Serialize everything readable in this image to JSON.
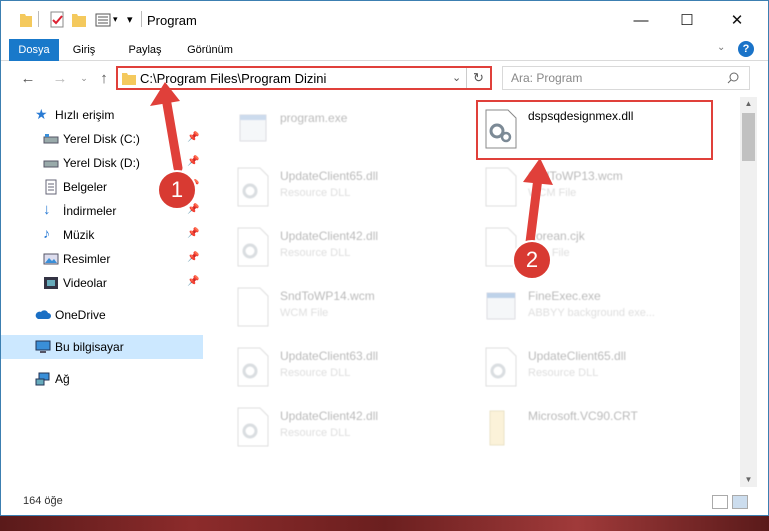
{
  "window": {
    "title": "Program"
  },
  "ribbon": {
    "tabs": [
      "Dosya",
      "Giriş",
      "Paylaş",
      "Görünüm"
    ]
  },
  "address": {
    "path": "C:\\Program Files\\Program Dizini"
  },
  "search": {
    "placeholder": "Ara: Program"
  },
  "sidebar": {
    "items": [
      {
        "label": "Hızlı erişim",
        "icon": "star-icon"
      },
      {
        "label": "Yerel Disk (C:)",
        "icon": "drive-icon"
      },
      {
        "label": "Yerel Disk (D:)",
        "icon": "drive-icon"
      },
      {
        "label": "Belgeler",
        "icon": "documents-icon"
      },
      {
        "label": "İndirmeler",
        "icon": "download-icon"
      },
      {
        "label": "Müzik",
        "icon": "music-icon"
      },
      {
        "label": "Resimler",
        "icon": "pictures-icon"
      },
      {
        "label": "Videolar",
        "icon": "video-icon"
      },
      {
        "label": "OneDrive",
        "icon": "cloud-icon"
      },
      {
        "label": "Bu bilgisayar",
        "icon": "computer-icon"
      },
      {
        "label": "Ağ",
        "icon": "network-icon"
      }
    ]
  },
  "files": [
    {
      "name": "program.exe",
      "type": ""
    },
    {
      "name": "dspsqdesignmex.dll",
      "type": ""
    },
    {
      "name": "UpdateClient65.dll",
      "type": "Resource DLL"
    },
    {
      "name": "SndToWP13.wcm",
      "type": "WCM File"
    },
    {
      "name": "UpdateClient42.dll",
      "type": "Resource DLL"
    },
    {
      "name": "Korean.cjk",
      "type": "CJK File"
    },
    {
      "name": "SndToWP14.wcm",
      "type": "WCM File"
    },
    {
      "name": "FineExec.exe",
      "type": "ABBYY background exe..."
    },
    {
      "name": "UpdateClient63.dll",
      "type": "Resource DLL"
    },
    {
      "name": "UpdateClient65.dll",
      "type": "Resource DLL"
    },
    {
      "name": "UpdateClient42.dll",
      "type": "Resource DLL"
    },
    {
      "name": "Microsoft.VC90.CRT",
      "type": ""
    }
  ],
  "status": {
    "count": "164 öğe"
  },
  "annotations": {
    "step1": "1",
    "step2": "2"
  },
  "colors": {
    "accent": "#1979ca",
    "highlight": "#e0403a",
    "selection": "#cce8ff"
  }
}
